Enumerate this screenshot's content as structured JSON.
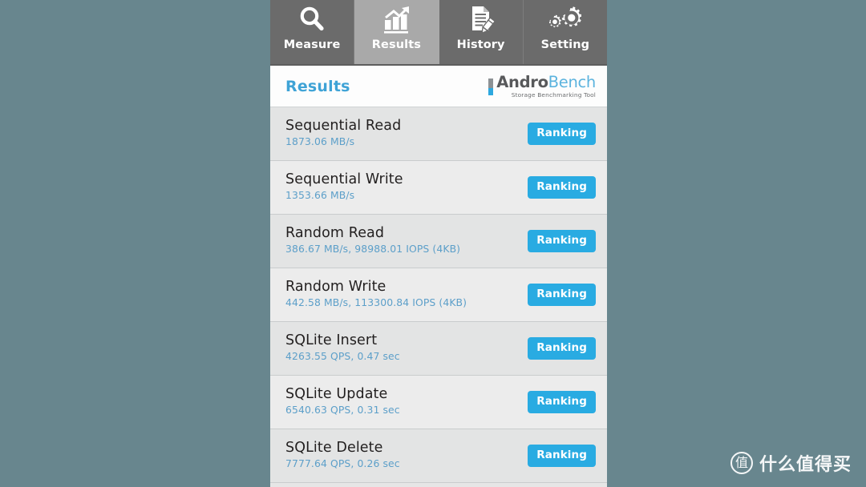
{
  "background_color": "#68868e",
  "tabs": [
    {
      "label": "Measure",
      "icon": "magnifier-icon",
      "active": false
    },
    {
      "label": "Results",
      "icon": "bar-chart-icon",
      "active": true
    },
    {
      "label": "History",
      "icon": "document-pencil-icon",
      "active": false
    },
    {
      "label": "Setting",
      "icon": "gears-icon",
      "active": false
    }
  ],
  "header": {
    "title": "Results",
    "brand_primary": "Andro",
    "brand_secondary": "Bench",
    "brand_tagline": "Storage Benchmarking Tool",
    "title_color": "#3fa3d6",
    "brand_accent_color": "#2ea8df"
  },
  "results": {
    "ranking_label": "Ranking",
    "button_color": "#29abe2",
    "value_color": "#5c9fc9",
    "rows": [
      {
        "title": "Sequential Read",
        "value": "1873.06 MB/s"
      },
      {
        "title": "Sequential Write",
        "value": "1353.66 MB/s"
      },
      {
        "title": "Random Read",
        "value": "386.67 MB/s, 98988.01 IOPS (4KB)"
      },
      {
        "title": "Random Write",
        "value": "442.58 MB/s, 113300.84 IOPS (4KB)"
      },
      {
        "title": "SQLite Insert",
        "value": "4263.55 QPS, 0.47 sec"
      },
      {
        "title": "SQLite Update",
        "value": "6540.63 QPS, 0.31 sec"
      },
      {
        "title": "SQLite Delete",
        "value": "7777.64 QPS, 0.26 sec"
      }
    ]
  },
  "watermark": {
    "logo_glyph": "值",
    "text": "什么值得买"
  }
}
